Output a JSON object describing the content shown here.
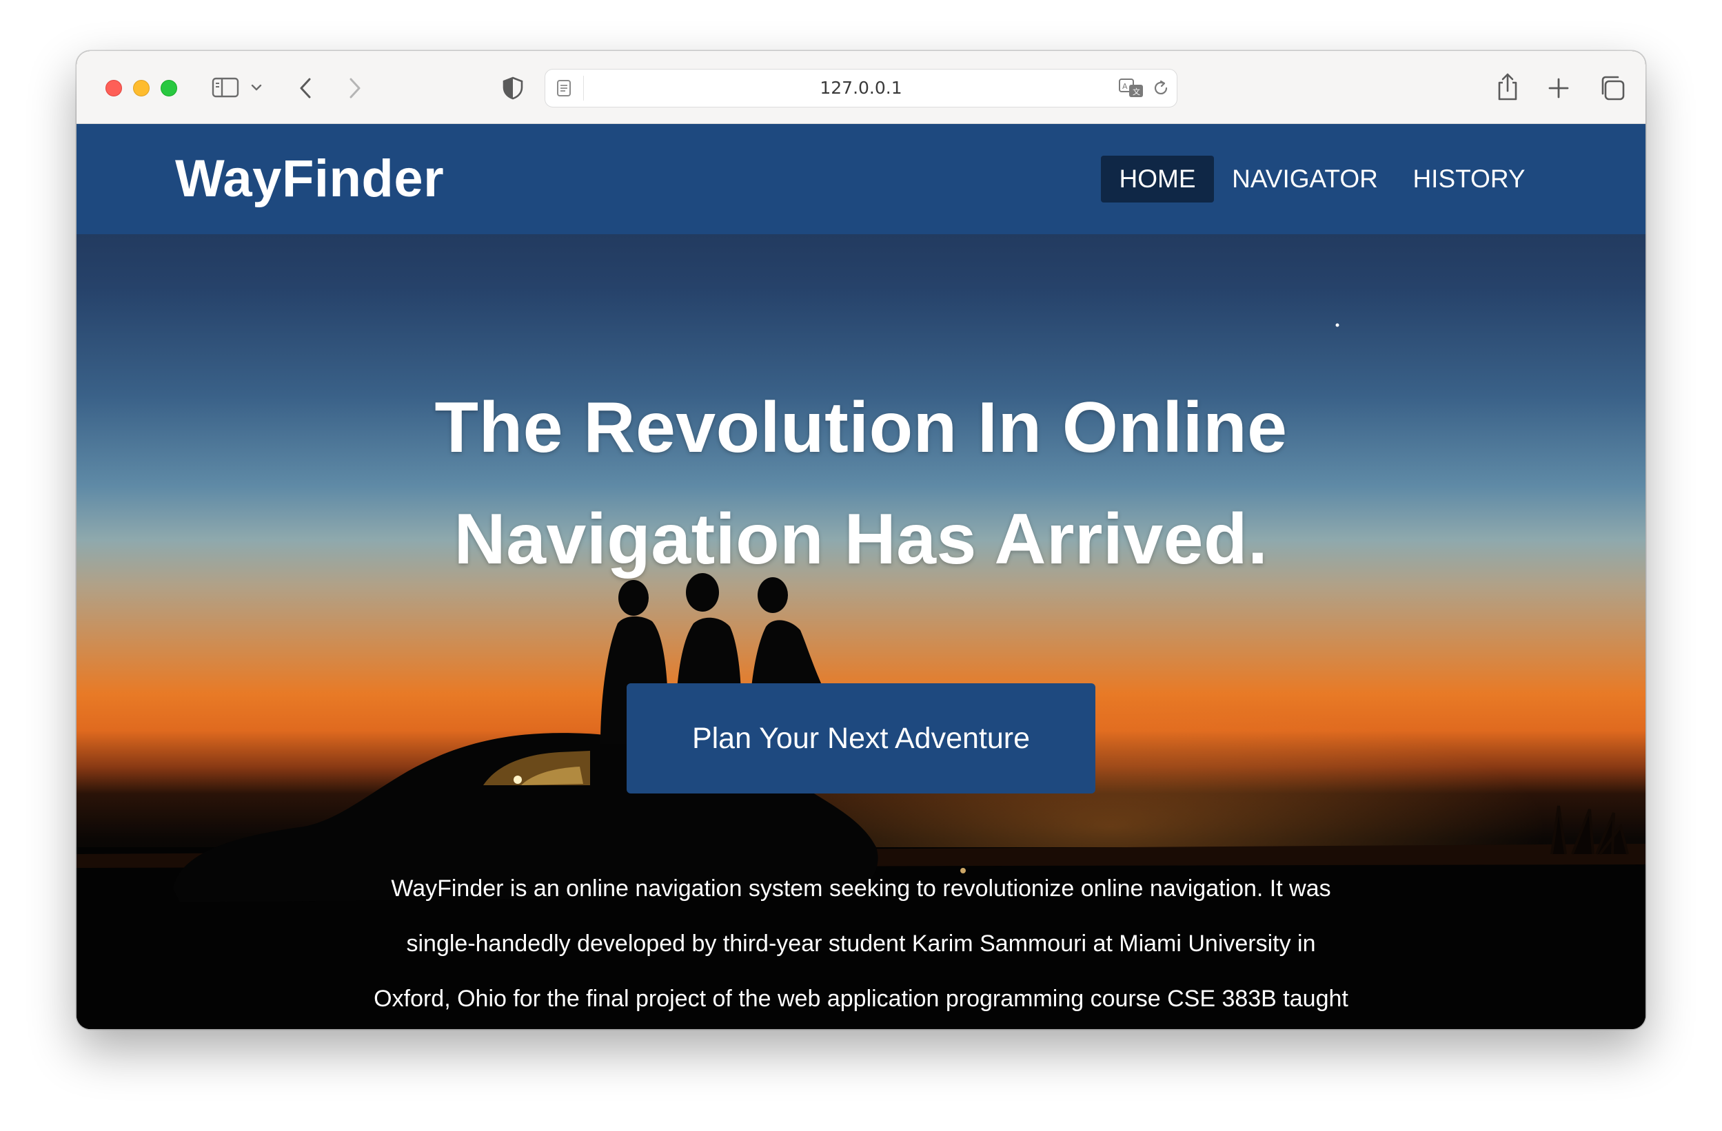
{
  "browser": {
    "url": "127.0.0.1",
    "icons": [
      "sidebar-icon",
      "chevron-down-icon",
      "back-icon",
      "forward-icon",
      "shield-icon",
      "reader-icon",
      "translate-icon",
      "reload-icon",
      "share-icon",
      "new-tab-icon",
      "tabs-overview-icon"
    ]
  },
  "navbar": {
    "brand": "WayFinder",
    "items": [
      {
        "label": "HOME",
        "active": true
      },
      {
        "label": "NAVIGATOR",
        "active": false
      },
      {
        "label": "HISTORY",
        "active": false
      }
    ]
  },
  "hero": {
    "headline_line1": "The Revolution In Online",
    "headline_line2": "Navigation Has Arrived.",
    "cta_label": "Plan Your Next Adventure",
    "paragraph_lines": [
      "WayFinder is an online navigation system seeking to revolutionize online navigation. It was",
      "single-handedly developed by third-year student Karim Sammouri at Miami University in",
      "Oxford, Ohio for the final project of the web application programming course CSE 383B taught"
    ]
  },
  "colors": {
    "navbar": "#1e497f",
    "nav_active": "#0f2746",
    "cta": "#1e497f"
  }
}
